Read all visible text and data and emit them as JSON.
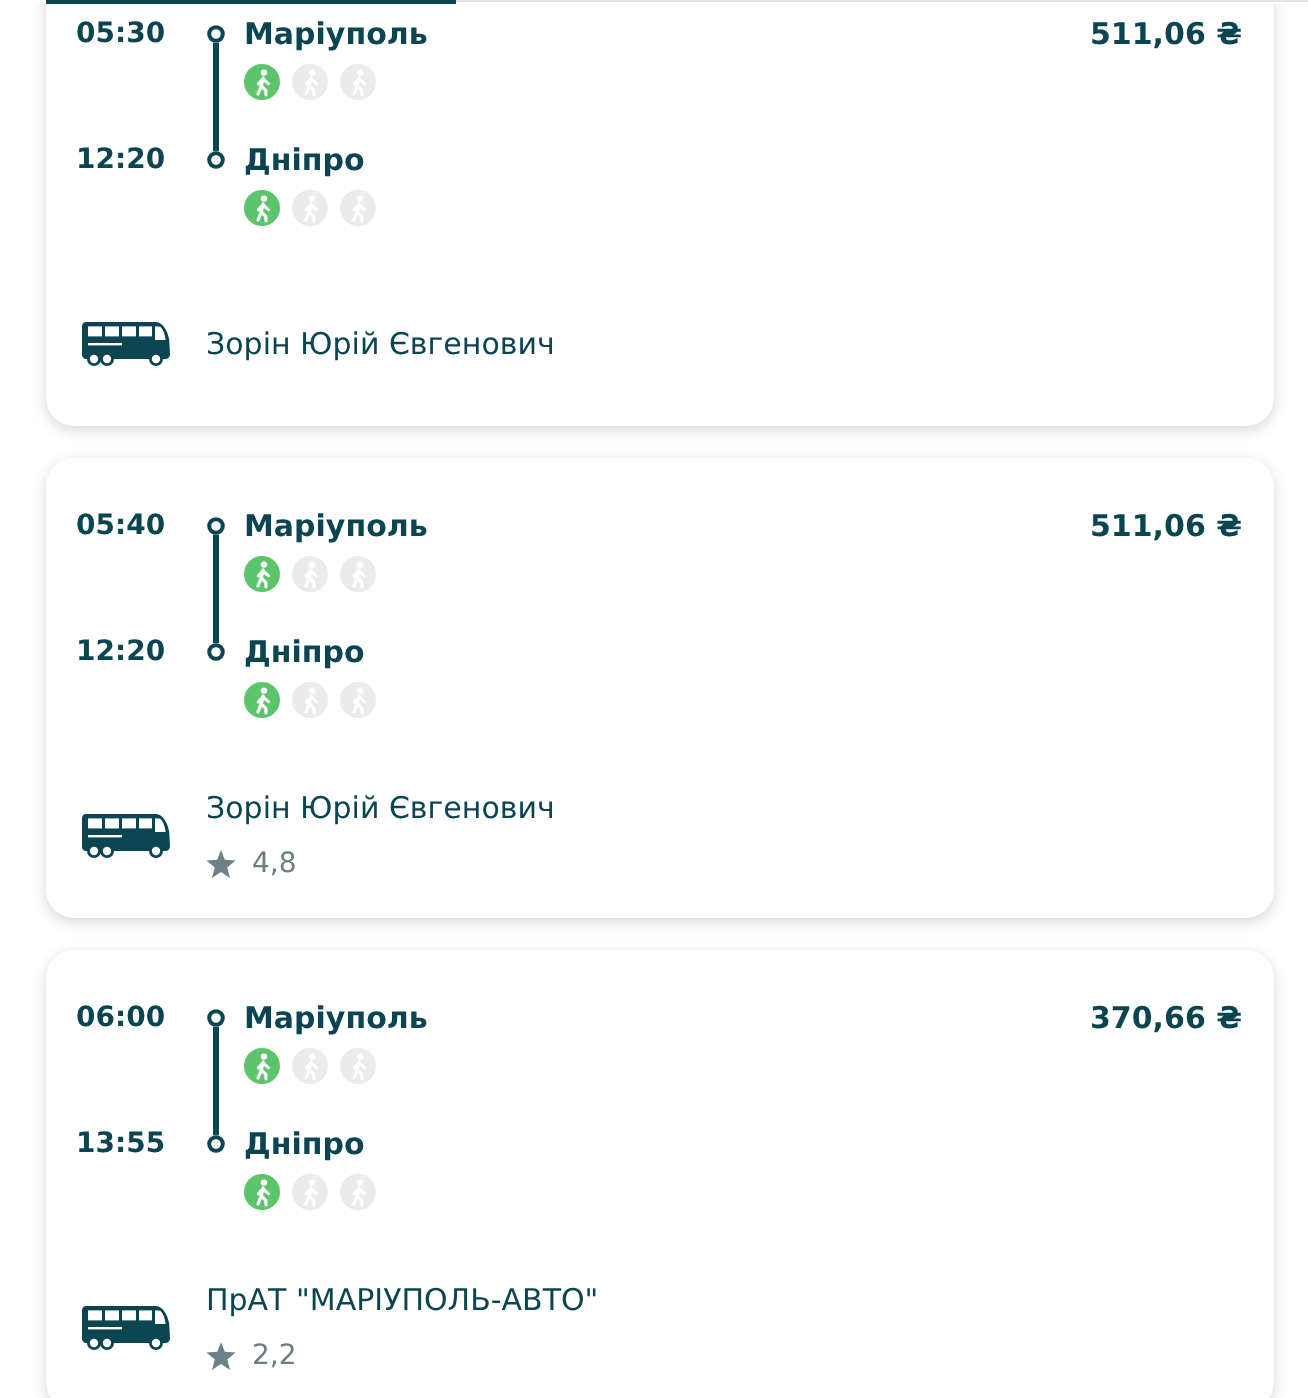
{
  "trips": [
    {
      "stops": [
        {
          "time": "05:30",
          "city": "Маріуполь",
          "person_icons": [
            {
              "active": true
            },
            {
              "active": false
            },
            {
              "active": false
            }
          ]
        },
        {
          "time": "12:20",
          "city": "Дніпро",
          "person_icons": [
            {
              "active": true
            },
            {
              "active": false
            },
            {
              "active": false
            }
          ]
        }
      ],
      "price": "511,06 ₴",
      "operator": "Зорін Юрій Євгенович"
    },
    {
      "stops": [
        {
          "time": "05:40",
          "city": "Маріуполь",
          "person_icons": [
            {
              "active": true
            },
            {
              "active": false
            },
            {
              "active": false
            }
          ]
        },
        {
          "time": "12:20",
          "city": "Дніпро",
          "person_icons": [
            {
              "active": true
            },
            {
              "active": false
            },
            {
              "active": false
            }
          ]
        }
      ],
      "price": "511,06 ₴",
      "operator": "Зорін Юрій Євгенович",
      "rating": "4,8"
    },
    {
      "stops": [
        {
          "time": "06:00",
          "city": "Маріуполь",
          "person_icons": [
            {
              "active": true
            },
            {
              "active": false
            },
            {
              "active": false
            }
          ]
        },
        {
          "time": "13:55",
          "city": "Дніпро",
          "person_icons": [
            {
              "active": true
            },
            {
              "active": false
            },
            {
              "active": false
            }
          ]
        }
      ],
      "price": "370,66 ₴",
      "operator": "ПрАТ \"МАРІУПОЛЬ-АВТО\"",
      "rating": "2,2"
    }
  ]
}
